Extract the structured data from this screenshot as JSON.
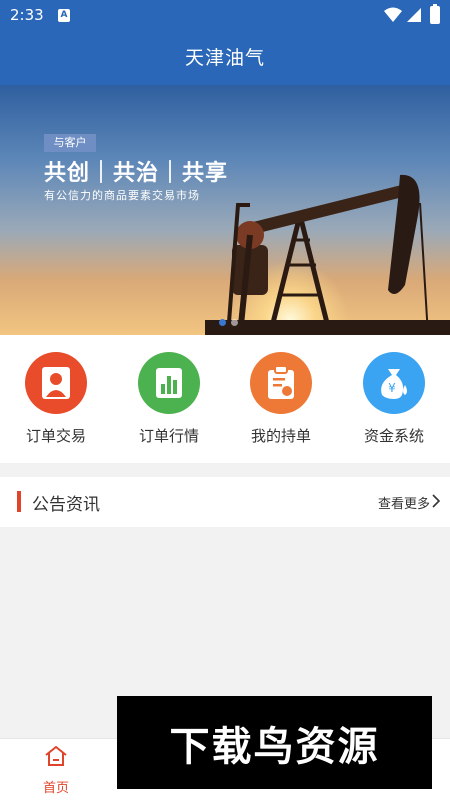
{
  "status_bar": {
    "time": "2:33",
    "notification": "A"
  },
  "header": {
    "title": "天津油气"
  },
  "banner": {
    "tag": "与客户",
    "slogan": "共创｜共治｜共享",
    "subtitle": "有公信力的商品要素交易市场"
  },
  "menu": {
    "items": [
      {
        "label": "订单交易",
        "icon": "user-icon",
        "color": "#e84c2a"
      },
      {
        "label": "订单行情",
        "icon": "chart-icon",
        "color": "#4cb24f"
      },
      {
        "label": "我的持单",
        "icon": "clipboard-icon",
        "color": "#ee7936"
      },
      {
        "label": "资金系统",
        "icon": "money-bag-icon",
        "color": "#3aa3f2"
      }
    ]
  },
  "notice": {
    "title": "公告资讯",
    "more": "查看更多"
  },
  "bottom_nav": {
    "items": [
      {
        "label": "首页",
        "active": true
      }
    ]
  },
  "watermark": "下载鸟资源",
  "colors": {
    "header_bg": "#2a67b8",
    "accent_red": "#e0452c"
  }
}
